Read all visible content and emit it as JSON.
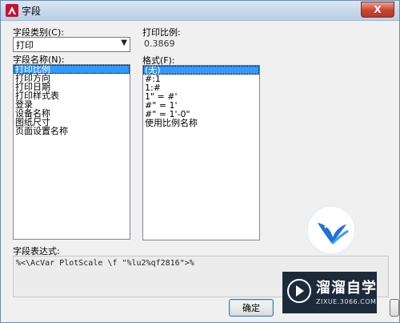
{
  "window": {
    "title": "字段",
    "close_symbol": "X"
  },
  "category": {
    "label": "字段类别(C):",
    "selected": "打印"
  },
  "field_names": {
    "label": "字段名称(N):",
    "items": [
      "打印比例",
      "打印方向",
      "打印日期",
      "打印样式表",
      "登录",
      "设备名称",
      "图纸尺寸",
      "页面设置名称"
    ],
    "selected_index": 0
  },
  "scale": {
    "label": "打印比例:",
    "value": "0.3869"
  },
  "format": {
    "label": "格式(F):",
    "items": [
      "(无)",
      "#:1",
      "1:#",
      "1\" = #'",
      "#\" = 1'",
      "#\" = 1'-0\"",
      "使用比例名称"
    ],
    "selected_index": 0
  },
  "expression": {
    "label": "字段表达式:",
    "value": "%<\\AcVar PlotScale \\f \"%lu2%qf2816\">%"
  },
  "buttons": {
    "ok": "确定"
  },
  "watermark": {
    "name": "溜溜自学",
    "url": "ZIXUE.3066.COM"
  },
  "colors": {
    "accent": "#3399ff",
    "titlebar": "#c8d8ea",
    "close": "#c9432f"
  }
}
